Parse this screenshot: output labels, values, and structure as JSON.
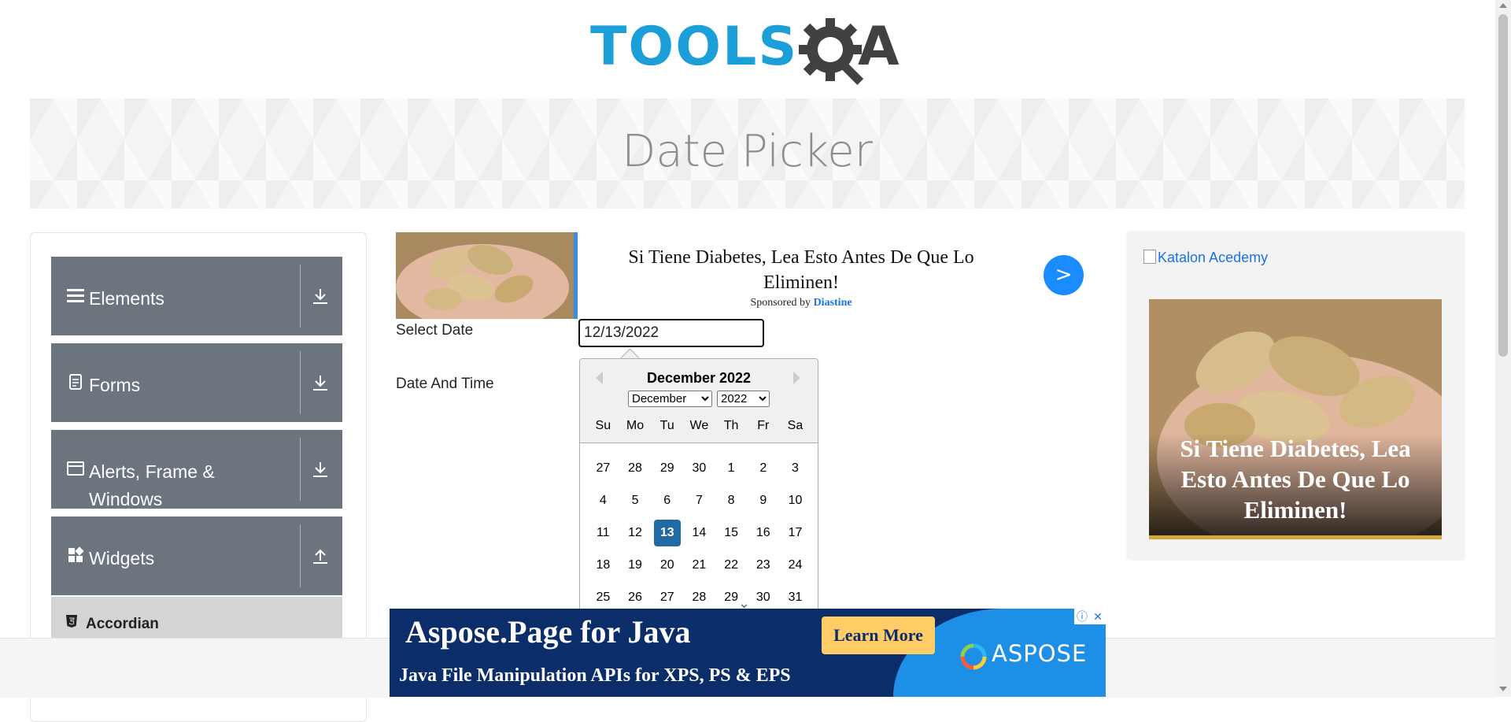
{
  "logo": {
    "text_left": "TOOLS",
    "text_right": "A"
  },
  "banner": {
    "title": "Date Picker"
  },
  "sidebar": {
    "groups": [
      {
        "label": "Elements",
        "icon": "hamburger-icon",
        "arrow": "download-arrow-icon"
      },
      {
        "label": "Forms",
        "icon": "document-icon",
        "arrow": "download-arrow-icon"
      },
      {
        "label": "Alerts, Frame & Windows",
        "icon": "window-icon",
        "arrow": "download-arrow-icon"
      },
      {
        "label": "Widgets",
        "icon": "widgets-icon",
        "arrow": "upload-arrow-icon"
      }
    ],
    "active_item": "Accordian"
  },
  "ad_top": {
    "headline": "Si Tiene Diabetes, Lea Esto Antes De Que Lo Eliminen!",
    "sponsored_prefix": "Sponsored by",
    "sponsor": "Diastine",
    "button": ">"
  },
  "form": {
    "select_date_label": "Select Date",
    "date_time_label": "Date And Time",
    "date_value": "12/13/2022"
  },
  "calendar": {
    "title": "December 2022",
    "month_selected": "December",
    "year_selected": "2022",
    "weekdays": [
      "Su",
      "Mo",
      "Tu",
      "We",
      "Th",
      "Fr",
      "Sa"
    ],
    "weeks": [
      [
        "27",
        "28",
        "29",
        "30",
        "1",
        "2",
        "3"
      ],
      [
        "4",
        "5",
        "6",
        "7",
        "8",
        "9",
        "10"
      ],
      [
        "11",
        "12",
        "13",
        "14",
        "15",
        "16",
        "17"
      ],
      [
        "18",
        "19",
        "20",
        "21",
        "22",
        "23",
        "24"
      ],
      [
        "25",
        "26",
        "27",
        "28",
        "29",
        "30",
        "31"
      ]
    ],
    "selected_day": "13"
  },
  "ad_right": {
    "link_text": "Katalon Acedemy",
    "headline": "Si Tiene Diabetes, Lea Esto Antes De Que Lo Eliminen!"
  },
  "ad_bottom": {
    "title": "Aspose.Page for Java",
    "subtitle": "Java File Manipulation APIs for XPS, PS & EPS",
    "button": "Learn More",
    "brand": "ASPOSE",
    "choices_info": "ⓘ",
    "choices_close": "✕"
  },
  "colors": {
    "brand_blue": "#1c9fd8",
    "sidebar_group": "#6c757d",
    "selected_day": "#216ba5",
    "ad_button": "#1a8cff"
  }
}
